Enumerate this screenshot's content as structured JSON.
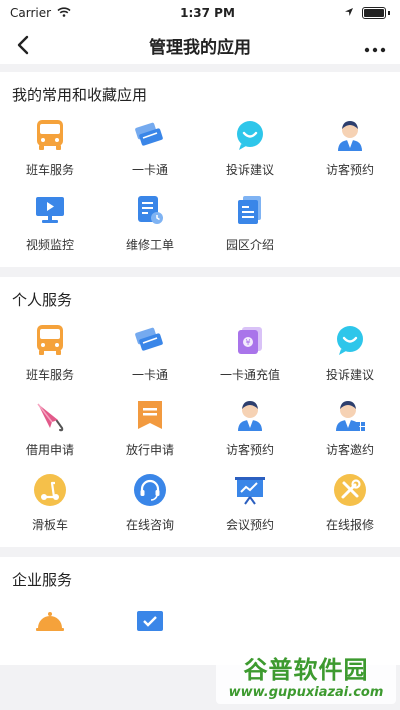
{
  "status_bar": {
    "carrier": "Carrier",
    "time": "1:37 PM"
  },
  "nav": {
    "title": "管理我的应用"
  },
  "sections": [
    {
      "title": "我的常用和收藏应用",
      "apps": [
        {
          "label": "班车服务",
          "icon": "bus-icon"
        },
        {
          "label": "一卡通",
          "icon": "cards-icon"
        },
        {
          "label": "投诉建议",
          "icon": "chat-bubble-icon"
        },
        {
          "label": "访客预约",
          "icon": "visitor-icon"
        },
        {
          "label": "视频监控",
          "icon": "monitor-icon"
        },
        {
          "label": "维修工单",
          "icon": "work-order-icon"
        },
        {
          "label": "园区介绍",
          "icon": "document-icon"
        }
      ]
    },
    {
      "title": "个人服务",
      "apps": [
        {
          "label": "班车服务",
          "icon": "bus-icon"
        },
        {
          "label": "一卡通",
          "icon": "cards-icon"
        },
        {
          "label": "一卡通充值",
          "icon": "recharge-icon"
        },
        {
          "label": "投诉建议",
          "icon": "chat-bubble-icon"
        },
        {
          "label": "借用申请",
          "icon": "umbrella-icon"
        },
        {
          "label": "放行申请",
          "icon": "pass-icon"
        },
        {
          "label": "访客预约",
          "icon": "visitor-icon"
        },
        {
          "label": "访客邀约",
          "icon": "visitor-invite-icon"
        },
        {
          "label": "滑板车",
          "icon": "scooter-icon"
        },
        {
          "label": "在线咨询",
          "icon": "headset-icon"
        },
        {
          "label": "会议预约",
          "icon": "presentation-icon"
        },
        {
          "label": "在线报修",
          "icon": "tools-icon"
        }
      ]
    },
    {
      "title": "企业服务",
      "apps": [
        {
          "label": "",
          "icon": "service-bell-icon"
        },
        {
          "label": "",
          "icon": "check-mail-icon"
        }
      ]
    }
  ],
  "watermark": {
    "title": "谷普软件园",
    "url": "www.gupuxiazai.com"
  },
  "colors": {
    "blue": "#3a86e8",
    "orange": "#f5a23b",
    "cyan": "#2ec6ea",
    "purple": "#a974ea",
    "pink": "#e25a8a",
    "yellow": "#f5c04a",
    "green": "#3d9a2f"
  }
}
